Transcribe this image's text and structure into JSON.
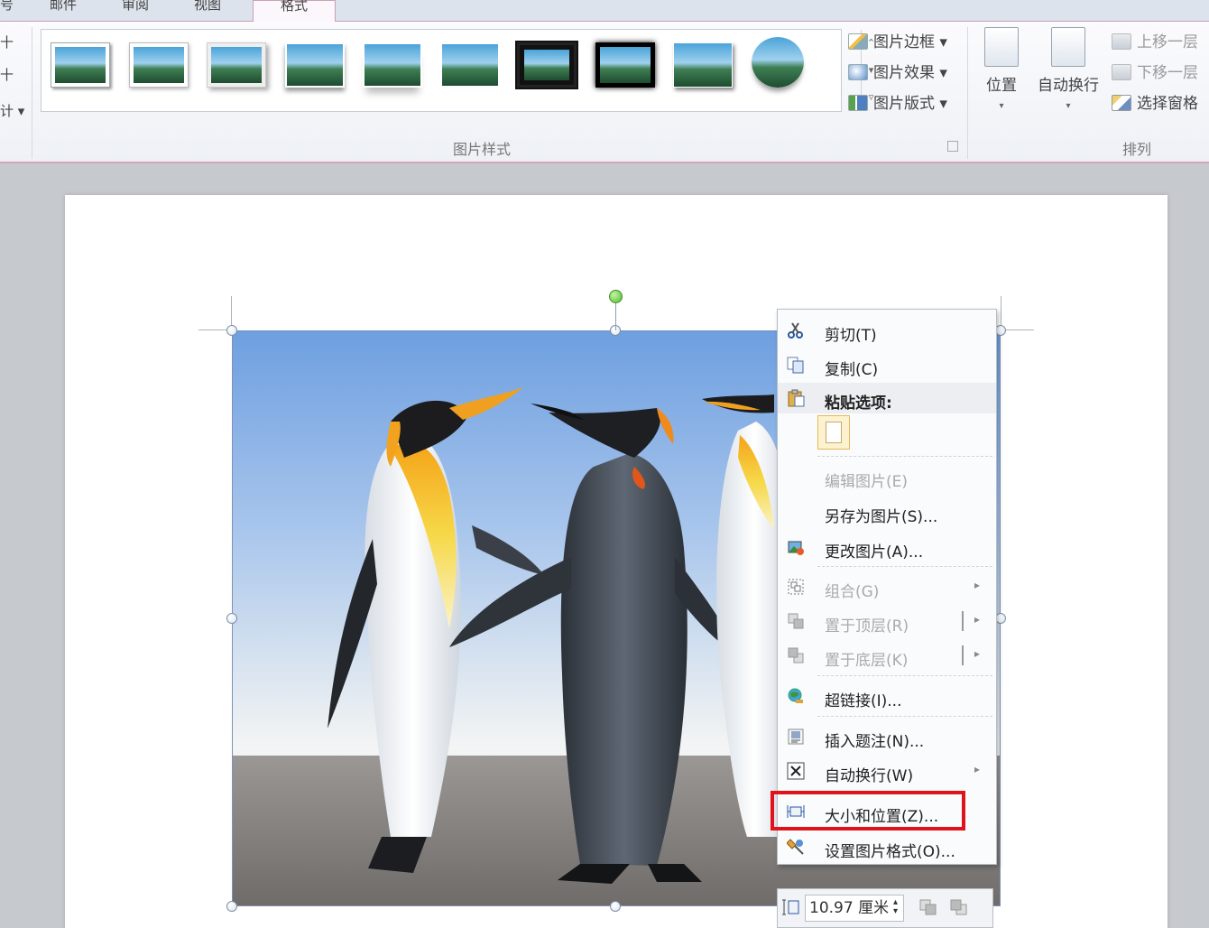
{
  "tabs": [
    {
      "label": "号"
    },
    {
      "label": "邮件"
    },
    {
      "label": "审阅"
    },
    {
      "label": "视图"
    },
    {
      "label": "格式",
      "active": true
    }
  ],
  "ribbon": {
    "left_items": [
      "十",
      "十",
      "计 ▾"
    ],
    "picture_style_commands": [
      {
        "label": "图片边框 ▾",
        "icon": "picture-border-icon"
      },
      {
        "label": "图片效果 ▾",
        "icon": "picture-effects-icon"
      },
      {
        "label": "图片版式 ▾",
        "icon": "picture-layout-icon"
      }
    ],
    "picture_styles_group_label": "图片样式",
    "arrange": {
      "position_label": "位置",
      "wrap_text_label": "自动换行",
      "bring_forward_label": "上移一层",
      "send_backward_label": "下移一层",
      "selection_pane_label": "选择窗格",
      "group_label": "排列",
      "dropdown_arrow": "▾"
    },
    "gallery_scroll": [
      "⌃",
      "▾",
      "▿"
    ]
  },
  "context_menu": {
    "items": [
      {
        "label": "剪切(T)",
        "icon": "scissors-icon",
        "enabled": true
      },
      {
        "label": "复制(C)",
        "icon": "copy-icon",
        "enabled": true
      },
      {
        "label": "粘贴选项:",
        "icon": "paste-icon",
        "enabled": true,
        "header": true
      },
      {
        "label": "编辑图片(E)",
        "enabled": false
      },
      {
        "label": "另存为图片(S)...",
        "enabled": true
      },
      {
        "label": "更改图片(A)...",
        "icon": "change-picture-icon",
        "enabled": true
      },
      {
        "label": "组合(G)",
        "icon": "group-icon",
        "enabled": false,
        "submenu": true
      },
      {
        "label": "置于顶层(R)",
        "icon": "bring-to-front-icon",
        "enabled": false,
        "submenu": true
      },
      {
        "label": "置于底层(K)",
        "icon": "send-to-back-icon",
        "enabled": false,
        "submenu": true
      },
      {
        "label": "超链接(I)...",
        "icon": "hyperlink-icon",
        "enabled": true
      },
      {
        "label": "插入题注(N)...",
        "icon": "insert-caption-icon",
        "enabled": true
      },
      {
        "label": "自动换行(W)",
        "icon": "wrap-text-icon",
        "enabled": true,
        "submenu": true
      },
      {
        "label": "大小和位置(Z)...",
        "icon": "size-position-icon",
        "enabled": true,
        "highlighted": true
      },
      {
        "label": "设置图片格式(O)...",
        "icon": "format-picture-icon",
        "enabled": true
      }
    ],
    "submenu_arrow": "▸"
  },
  "mini_toolbar": {
    "size_value": "10.97 厘米",
    "spin_up": "▴",
    "spin_down": "▾"
  },
  "colors": {
    "highlight": "#e0131b",
    "rotation_handle": "#4cbb2d",
    "ribbon_accent": "#d3a4c0"
  }
}
